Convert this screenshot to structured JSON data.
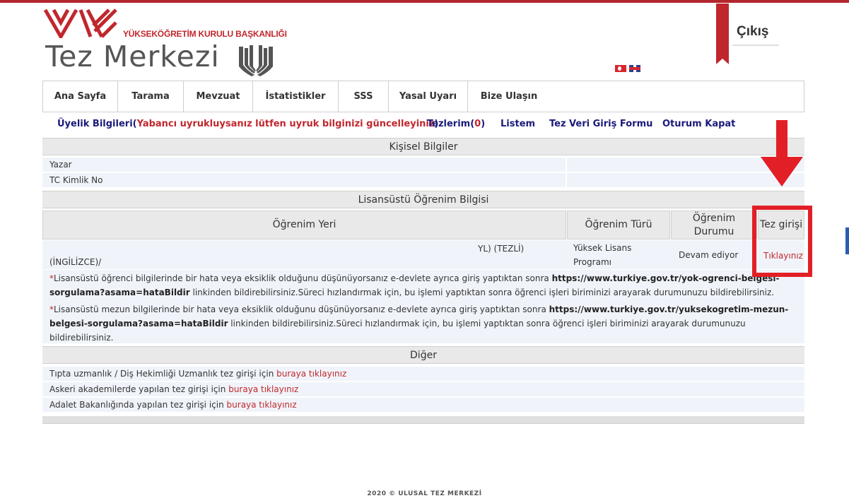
{
  "header": {
    "org_name": "YÜKSEKÖĞRETİM KURULU BAŞKANLIĞI",
    "site_title": "Tez Merkezi",
    "logout_label": "Çıkış",
    "brand_color": "#c0272d"
  },
  "nav": {
    "items": [
      {
        "label": "Ana Sayfa"
      },
      {
        "label": "Tarama"
      },
      {
        "label": "Mevzuat"
      },
      {
        "label": "İstatistikler"
      },
      {
        "label": "SSS"
      },
      {
        "label": "Yasal Uyarı"
      },
      {
        "label": "Bize Ulaşın"
      }
    ]
  },
  "subnav": {
    "membership_label": "Üyelik Bilgileri(",
    "membership_warning": "Yabancı uyrukluysanız lütfen uyruk bilginizi güncelleyiniz",
    "membership_close": ")",
    "theses_label": "Tezlerim(",
    "theses_count": "0",
    "theses_close": ")",
    "list_label": "Listem",
    "form_label": "Tez Veri Giriş Formu",
    "logout_label": "Oturum Kapat"
  },
  "personal": {
    "title": "Kişisel Bilgiler",
    "author_label": "Yazar",
    "tc_label": "TC Kimlik No"
  },
  "graduate": {
    "title": "Lisansüstü Öğrenim Bilgisi",
    "columns": {
      "place": "Öğrenim Yeri",
      "type": "Öğrenim Türü",
      "status": "Öğrenim Durumu",
      "entry": "Tez girişi"
    },
    "row": {
      "place_line1": "YL) (TEZLİ)",
      "place_line2": "(İNGİLİZCE)/",
      "type_line1": "Yüksek Lisans",
      "type_line2": "Programı",
      "status": "Devam ediyor",
      "entry_link": "Tıklayınız"
    },
    "notes": [
      {
        "star": "*",
        "text1": "Lisansüstü öğrenci bilgilerinde bir hata veya eksiklik olduğunu düşünüyorsanız e-devlete ayrıca giriş yaptıktan sonra ",
        "url": "https://www.turkiye.gov.tr/yok-ogrenci-belgesi-sorgulama?asama=hataBildir",
        "text2": " linkinden bildirebilirsiniz.Süreci hızlandırmak için, bu işlemi yaptıktan sonra öğrenci işleri biriminizi arayarak durumunuzu bildirebilirsiniz."
      },
      {
        "star": "*",
        "text1": "Lisansüstü mezun bilgilerinde bir hata veya eksiklik olduğunu düşünüyorsanız e-devlete ayrıca giriş yaptıktan sonra ",
        "url": "https://www.turkiye.gov.tr/yuksekogretim-mezun-belgesi-sorgulama?asama=hataBildir",
        "text2": " linkinden bildirebilirsiniz.Süreci hızlandırmak için, bu işlemi yaptıktan sonra öğrenci işleri biriminizi arayarak durumunuzu bildirebilirsiniz."
      }
    ]
  },
  "other": {
    "title": "Diğer",
    "items": [
      {
        "text": "Tıpta uzmanlık / Diş Hekimliği Uzmanlık tez girişi için ",
        "link": "buraya tıklayınız"
      },
      {
        "text": "Askeri akademilerde yapılan tez girişi için ",
        "link": "buraya tıklayınız"
      },
      {
        "text": "Adalet Bakanlığında yapılan tez girişi için ",
        "link": "buraya tıklayınız"
      }
    ]
  },
  "footer": {
    "text": "2020 © ULUSAL TEZ MERKEZİ"
  },
  "annotation": {
    "color": "#e21f26"
  }
}
